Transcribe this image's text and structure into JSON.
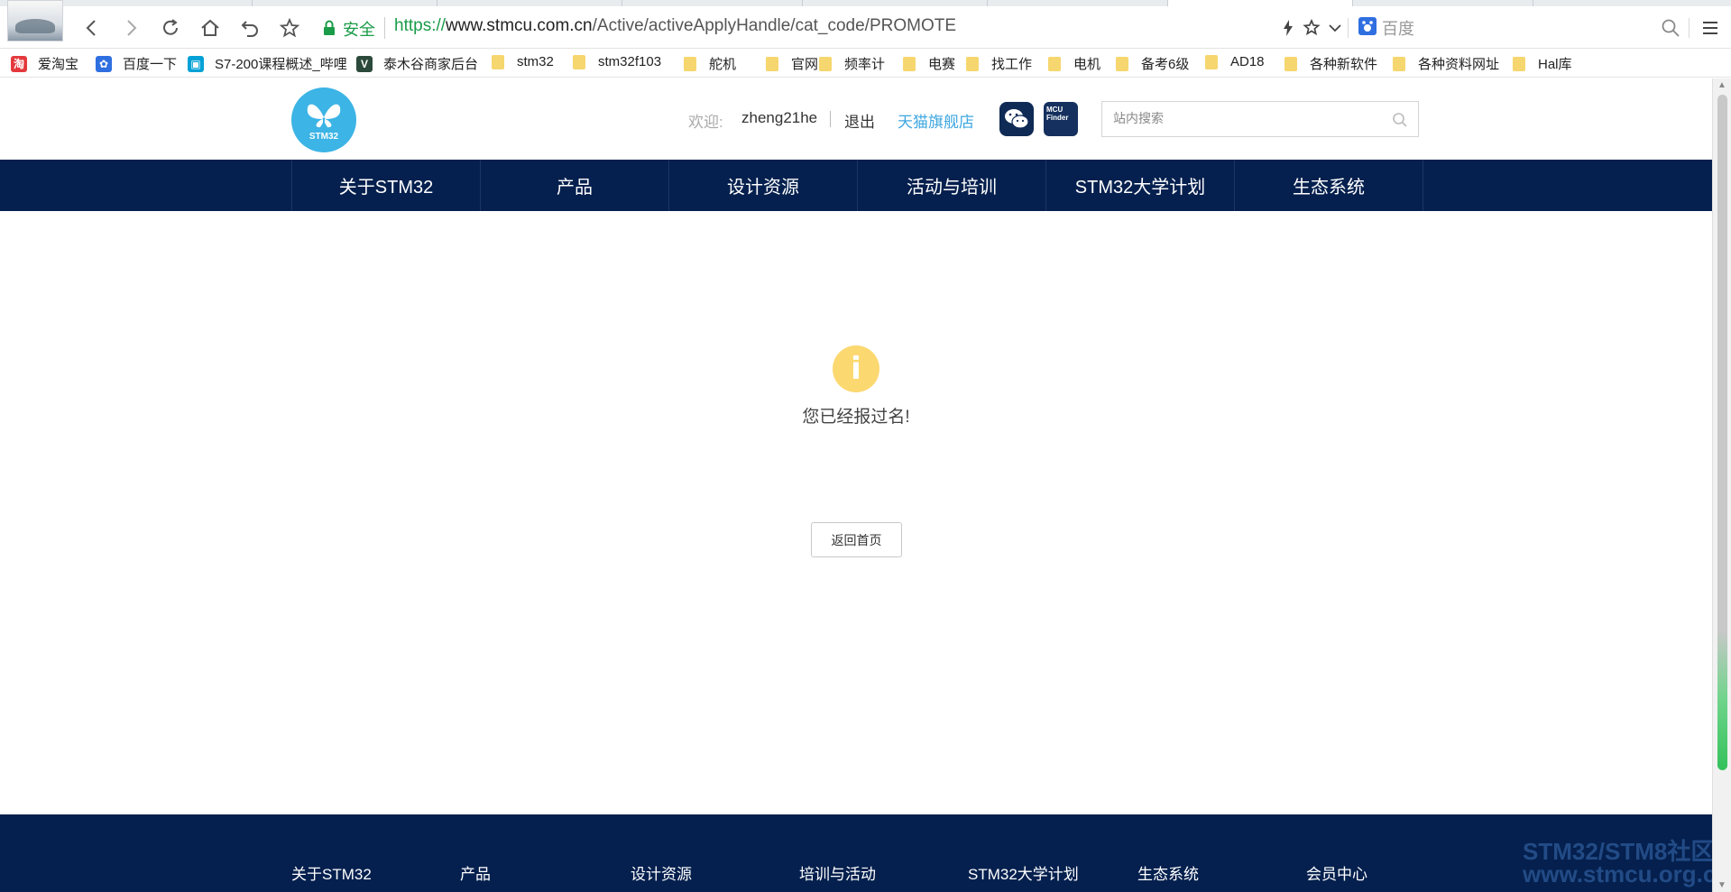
{
  "browser": {
    "url_protocol": "https://",
    "url_host": "www.stmcu.com.cn",
    "url_path": "/Active/activeApplyHandle/cat_code/PROMOTE",
    "secure_label": "安全",
    "search_engine_placeholder": "百度"
  },
  "bookmarks": [
    {
      "label": "爱淘宝",
      "icon": "taobao-icon",
      "color": "#e4393c"
    },
    {
      "label": "百度一下",
      "icon": "baidu-paw-icon",
      "color": "#2f6fe0"
    },
    {
      "label": "S7-200课程概述_哔哩",
      "icon": "bilibili-icon",
      "color": "#00a1d6"
    },
    {
      "label": "泰木谷商家后台",
      "icon": "v-logo-icon",
      "color": "#2c4a3b"
    },
    {
      "label": "stm32",
      "icon": "folder-icon"
    },
    {
      "label": "stm32f103",
      "icon": "folder-icon"
    },
    {
      "label": "舵机",
      "icon": "folder-icon"
    },
    {
      "label": "官网",
      "icon": "folder-icon"
    },
    {
      "label": "频率计",
      "icon": "folder-icon"
    },
    {
      "label": "电赛",
      "icon": "folder-icon"
    },
    {
      "label": "找工作",
      "icon": "folder-icon"
    },
    {
      "label": "电机",
      "icon": "folder-icon"
    },
    {
      "label": "备考6级",
      "icon": "folder-icon"
    },
    {
      "label": "AD18",
      "icon": "folder-icon"
    },
    {
      "label": "各种新软件",
      "icon": "folder-icon"
    },
    {
      "label": "各种资料网址",
      "icon": "folder-icon"
    },
    {
      "label": "Hal库",
      "icon": "folder-icon"
    }
  ],
  "header": {
    "logo_text": "STM32",
    "welcome": "欢迎:",
    "username": "zheng21he",
    "logout": "退出",
    "tmall": "天猫旗舰店",
    "mcu_finder": "MCU Finder",
    "search_placeholder": "站内搜索"
  },
  "nav": [
    "关于STM32",
    "产品",
    "设计资源",
    "活动与培训",
    "STM32大学计划",
    "生态系统"
  ],
  "notice": {
    "icon_glyph": "i",
    "message": "您已经报过名!",
    "back_button": "返回首页"
  },
  "footer": [
    "关于STM32",
    "产品",
    "设计资源",
    "培训与活动",
    "STM32大学计划",
    "生态系统",
    "会员中心"
  ],
  "watermark": {
    "line1": "STM32/STM8社区",
    "line2": "www.stmcu.org.cn"
  },
  "colors": {
    "nav_bg": "#05204e",
    "accent_blue": "#3fa7e0",
    "info_yellow": "#fcd870",
    "secure_green": "#1a9c48"
  }
}
